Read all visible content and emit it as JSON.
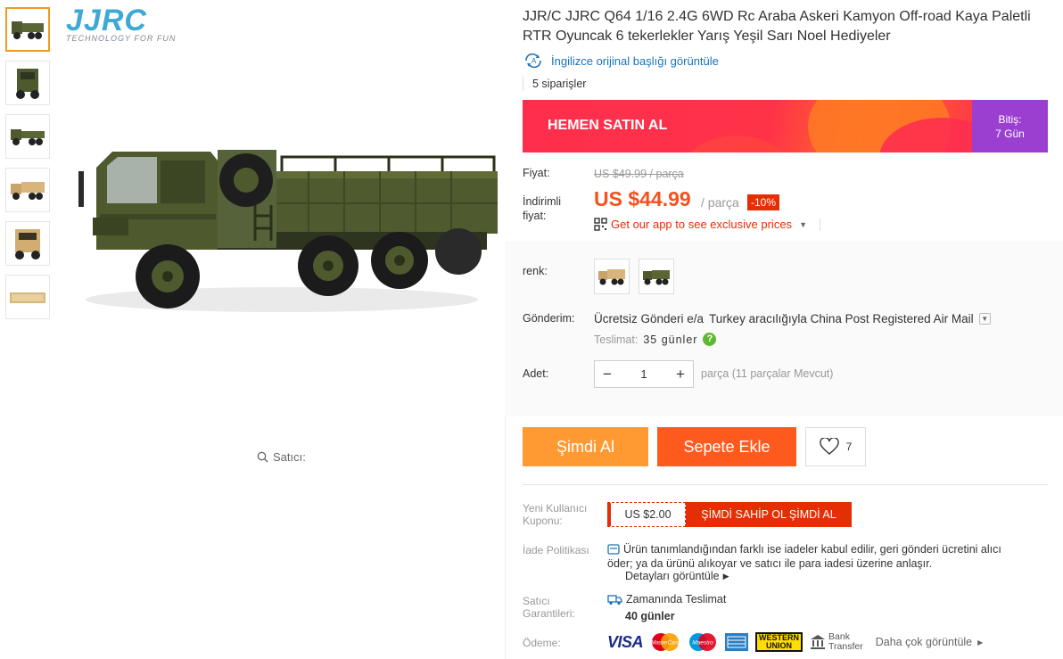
{
  "brand": {
    "wordmark": "JJRC",
    "tagline": "TECHNOLOGY FOR FUN"
  },
  "gallery": {
    "thumbnails": [
      "green-truck-front",
      "green-truck-cab",
      "green-truck-side",
      "tan-truck-side",
      "tan-truck-front",
      "tan-truck-bed"
    ],
    "zoom_hint": "Satıcı:"
  },
  "product": {
    "title": "JJR/C JJRC Q64 1/16 2.4G 6WD Rc Araba Askeri Kamyon Off-road Kaya Paletli RTR Oyuncak 6 tekerlekler Yarış Yeşil Sarı Noel Hediyeler",
    "translate_link": "İngilizce orijinal başlığı görüntüle",
    "orders": "5 siparişler"
  },
  "flash_sale": {
    "label": "HEMEN SATIN AL",
    "ends_label": "Bitiş:",
    "ends_value": "7 Gün"
  },
  "price": {
    "original_label": "Fiyat:",
    "original_value": "US $49.99 / parça",
    "discount_label": "İndirimli fiyat:",
    "current": "US $44.99",
    "unit": "/ parça",
    "discount_badge": "-10%",
    "app_promo": "Get our app to see exclusive prices"
  },
  "options": {
    "color_label": "renk:",
    "colors": [
      "tan",
      "green"
    ],
    "shipping_label": "Gönderim:",
    "shipping_bold": "Ücretsiz Gönderi e/a",
    "shipping_rest": "Turkey aracılığıyla China Post Registered Air Mail",
    "delivery_label": "Teslimat:",
    "delivery_value": "35 günler",
    "qty_label": "Adet:",
    "qty_value": "1",
    "qty_note": "parça (11 parçalar Mevcut)"
  },
  "actions": {
    "buy_now": "Şimdi Al",
    "add_to_cart": "Sepete Ekle",
    "wishlist_count": "7"
  },
  "coupon": {
    "label": "Yeni Kullanıcı Kuponu:",
    "value": "US $2.00",
    "cta": "ŞİMDİ SAHİP OL ŞİMDİ AL"
  },
  "returns": {
    "label": "İade Politikası",
    "text": "Ürün tanımlandığından farklı ise iadeler kabul edilir, geri gönderi ücretini alıcı öder; ya da ürünü alıkoyar ve satıcı ile para iadesi üzerine anlaşır.",
    "details": "Detayları görüntüle"
  },
  "guarantee": {
    "label": "Satıcı Garantileri:",
    "title": "Zamanında Teslimat",
    "value": "40 günler"
  },
  "payment": {
    "label": "Ödeme:",
    "methods": [
      "VISA",
      "MasterCard",
      "Maestro",
      "AMEX",
      "WESTERN UNION",
      "Bank Transfer"
    ],
    "bank_line1": "Bank",
    "bank_line2": "Transfer",
    "wu_line1": "WESTERN",
    "wu_line2": "UNION",
    "more": "Daha çok görüntüle"
  },
  "colors": {
    "accent": "#ff5a1e",
    "buy": "#ff9a33",
    "price": "#f5511e",
    "badge": "#e62e04",
    "flash_side": "#9b3fd0",
    "truck_green": "#4e5a2e",
    "truck_tan": "#c9a46a"
  }
}
